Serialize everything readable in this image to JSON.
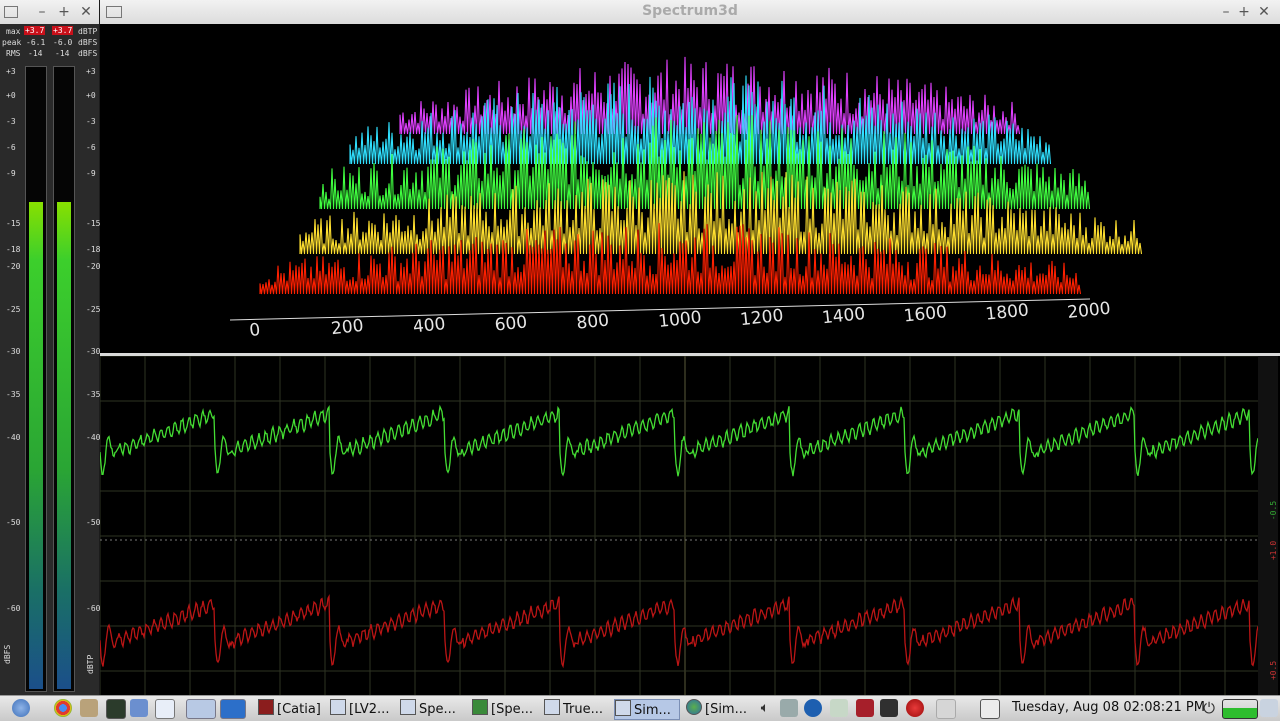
{
  "left_window": {
    "title_icons": [
      "menu-icon",
      "minimize-icon",
      "maximize-icon",
      "close-icon"
    ],
    "meter": {
      "header": {
        "max_label": "max",
        "max_l": "+3.7",
        "max_r": "+3.7",
        "max_unit": "dBTP",
        "peak_label": "peak",
        "peak_l": "-6.1",
        "peak_r": "-6.0",
        "peak_unit": "dBFS",
        "rms_label": "RMS",
        "rms_l": "-14",
        "rms_r": "-14",
        "rms_unit": "dBFS"
      },
      "scale": [
        "+3",
        "+0",
        "-3",
        "-6",
        "-9",
        "-15",
        "-18",
        "-20",
        "-25",
        "-30",
        "-35",
        "-40",
        "-50",
        "-60"
      ],
      "left_axis_label": "dBFS",
      "right_axis_label": "dBTP",
      "level_left": 0.78,
      "level_right": 0.78
    }
  },
  "spectrum_window": {
    "title": "Spectrum3d",
    "x_ticks": [
      "0",
      "200",
      "400",
      "600",
      "800",
      "1000",
      "1200",
      "1400",
      "1600",
      "1800",
      "2000"
    ],
    "colors": {
      "magenta": "#e040ff",
      "cyan": "#30e0ff",
      "green": "#40ff40",
      "yellow": "#ffe030",
      "red": "#ff2000"
    }
  },
  "scope": {
    "channel_top_color": "#44dd33",
    "channel_bottom_color": "#bb1515",
    "right_scale_top": "-0.5",
    "right_scale_mid": "+1.0",
    "right_scale_bottom": "+0.5"
  },
  "taskbar": {
    "tasks": [
      {
        "label": "[Catia]"
      },
      {
        "label": "[LV2..."
      },
      {
        "label": "Spe..."
      },
      {
        "label": "[Spe..."
      },
      {
        "label": "True..."
      },
      {
        "label": "Sim..."
      },
      {
        "label": "[Sim..."
      }
    ],
    "clock": "Tuesday, Aug 08 02:08:21 PM"
  }
}
